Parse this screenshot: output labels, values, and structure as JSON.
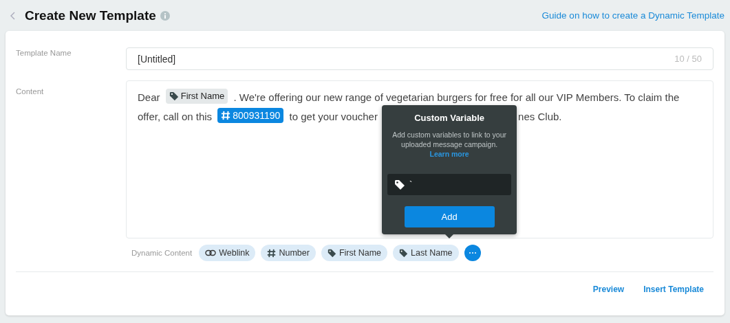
{
  "header": {
    "title": "Create New Template",
    "guide_link": "Guide on how to create a Dynamic Template"
  },
  "template_name": {
    "label": "Template Name",
    "value": "[Untitled]",
    "counter": "10 / 50"
  },
  "content": {
    "label": "Content",
    "segments": [
      {
        "kind": "text",
        "text": "Dear"
      },
      {
        "kind": "tag",
        "text": "First Name"
      },
      {
        "kind": "text",
        "text": ". We're offering our new range of vegetarian burgers for free for all our VIP Members. To claim the offer, call on this"
      },
      {
        "kind": "number",
        "text": "800931190"
      },
      {
        "kind": "text",
        "text": "to get your voucher"
      },
      {
        "kind": "hidden"
      },
      {
        "kind": "text",
        "text": "nes Club."
      }
    ]
  },
  "dynamic_content": {
    "label": "Dynamic Content",
    "chips": [
      {
        "kind": "link",
        "label": "Weblink"
      },
      {
        "kind": "number",
        "label": "Number"
      },
      {
        "kind": "tag",
        "label": "First Name"
      },
      {
        "kind": "tag",
        "label": "Last Name"
      }
    ]
  },
  "popover": {
    "title": "Custom Variable",
    "description": "Add custom variables to link to your uploaded message campaign.",
    "link": "Learn more",
    "input_value": "`",
    "button": "Add"
  },
  "actions": [
    "Preview",
    "Insert Template"
  ]
}
